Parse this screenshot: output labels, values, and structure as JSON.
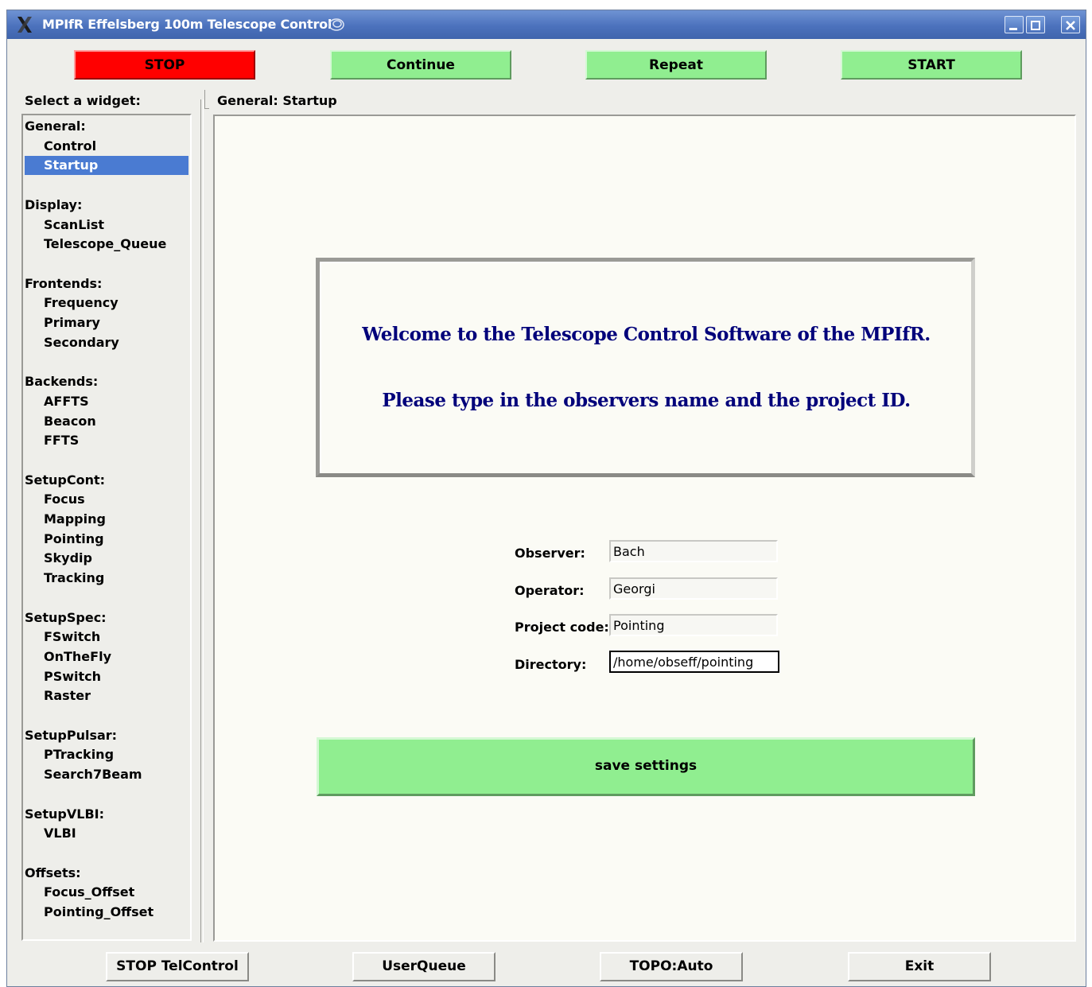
{
  "window": {
    "title": "MPIfR Effelsberg 100m Telescope Control",
    "controls": {
      "minimize": "minimize-icon",
      "maximize": "maximize-icon",
      "close": "close-icon"
    }
  },
  "toolbar": {
    "stop_label": "STOP",
    "continue_label": "Continue",
    "repeat_label": "Repeat",
    "start_label": "START"
  },
  "sidebar": {
    "label": "Select a widget:",
    "groups": [
      {
        "name": "General:",
        "items": [
          "Control",
          "Startup"
        ]
      },
      {
        "name": "Display:",
        "items": [
          "ScanList",
          "Telescope_Queue"
        ]
      },
      {
        "name": "Frontends:",
        "items": [
          "Frequency",
          "Primary",
          "Secondary"
        ]
      },
      {
        "name": "Backends:",
        "items": [
          "AFFTS",
          "Beacon",
          "FFTS"
        ]
      },
      {
        "name": "SetupCont:",
        "items": [
          "Focus",
          "Mapping",
          "Pointing",
          "Skydip",
          "Tracking"
        ]
      },
      {
        "name": "SetupSpec:",
        "items": [
          "FSwitch",
          "OnTheFly",
          "PSwitch",
          "Raster"
        ]
      },
      {
        "name": "SetupPulsar:",
        "items": [
          "PTracking",
          "Search7Beam"
        ]
      },
      {
        "name": "SetupVLBI:",
        "items": [
          "VLBI"
        ]
      },
      {
        "name": "Offsets:",
        "items": [
          "Focus_Offset",
          "Pointing_Offset"
        ]
      }
    ],
    "selected": "Startup"
  },
  "main": {
    "title": "General: Startup",
    "welcome_line1": "Welcome to the Telescope Control Software of the MPIfR.",
    "welcome_line2": "Please type in the observers name and the project ID.",
    "form": {
      "observer_label": "Observer:",
      "observer_value": "Bach",
      "operator_label": "Operator:",
      "operator_value": "Georgi",
      "project_label": "Project code:",
      "project_value": "Pointing",
      "directory_label": "Directory:",
      "directory_value": "/home/obseff/pointing"
    },
    "save_label": "save settings"
  },
  "bottom": {
    "stop_telcontrol_label": "STOP TelControl",
    "userqueue_label": "UserQueue",
    "topo_label": "TOPO:Auto",
    "exit_label": "Exit"
  },
  "colors": {
    "stop": "#ff0000",
    "go": "#90ee90",
    "selection": "#4a7bd2",
    "welcome_text": "#00007a",
    "titlebar": "#4c72bd"
  }
}
